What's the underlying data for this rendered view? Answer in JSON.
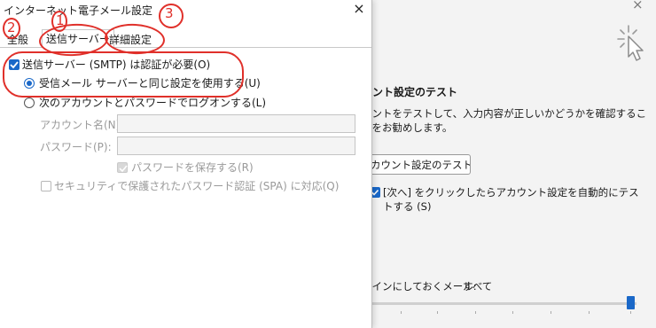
{
  "background": {
    "close_glyph": "×",
    "section_title": "ウント設定のテスト",
    "description": "ウントをテストして、入力内容が正しいかどうかを確認することをお勧めします。",
    "test_button_label": "カウント設定のテスト(T)",
    "auto_test_label": "[次へ] をクリックしたらアカウント設定を自動的にテストする (S)",
    "auto_test_checked": true,
    "offline_label": "ラインにしておくメール:",
    "offline_value": "すべて",
    "offline_slider_fraction": 1.0
  },
  "dialog": {
    "title": "インターネット電子メール設定",
    "close_glyph": "×",
    "tabs": [
      "全般",
      "送信サーバー",
      "詳細設定"
    ],
    "active_tab": "送信サーバー",
    "smtp_auth_label": "送信サーバー (SMTP) は認証が必要(O)",
    "smtp_auth_checked": true,
    "same_as_incoming_label": "受信メール サーバーと同じ設定を使用する(U)",
    "logon_with_label": "次のアカウントとパスワードでログオンする(L)",
    "account_name_label": "アカウント名(N):",
    "account_name_value": "",
    "password_label": "パスワード(P):",
    "password_value": "",
    "remember_password_label": "パスワードを保存する(R)",
    "spa_label": "セキュリティで保護されたパスワード認証 (SPA) に対応(Q)"
  },
  "annotations": {
    "num1": "1",
    "num2": "2",
    "num3": "3",
    "color": "#e0302a"
  },
  "colors": {
    "accent": "#1a68c8"
  }
}
